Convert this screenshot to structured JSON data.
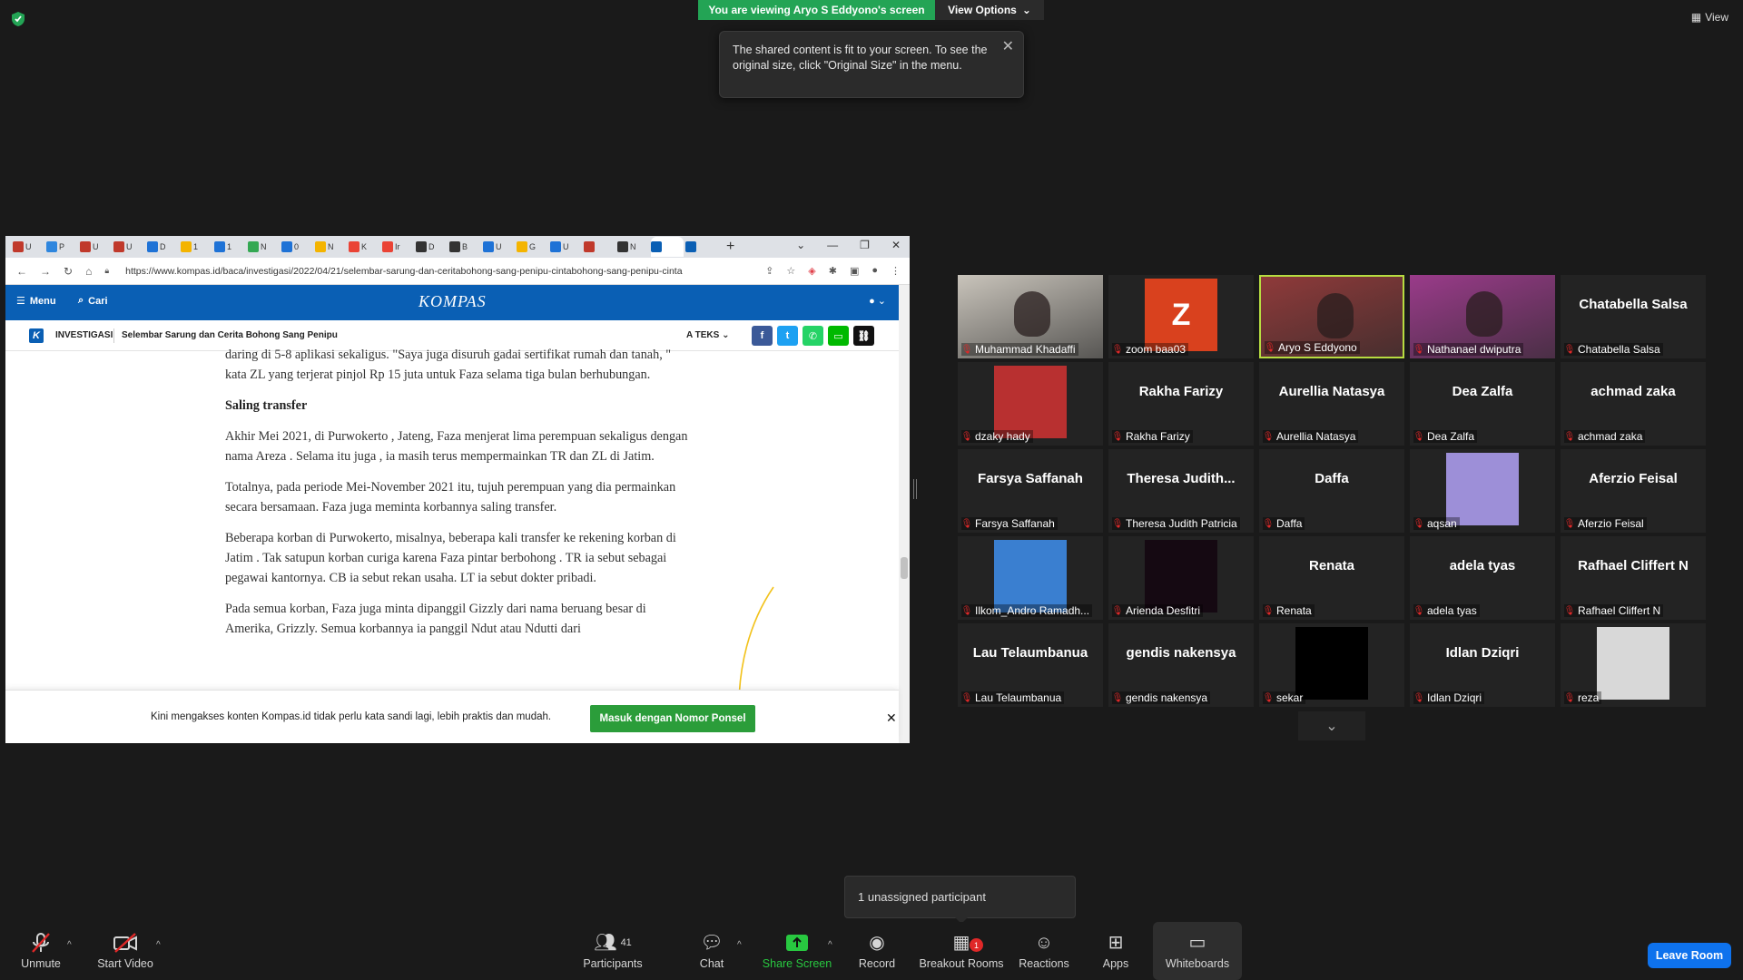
{
  "top": {
    "viewing_banner": "You are viewing Aryo S Eddyono's screen",
    "view_options": "View Options",
    "tooltip_text": "The shared content is fit to your screen. To see the original size, click \"Original Size\" in the menu.",
    "view_label": "View"
  },
  "browser": {
    "tabs": [
      "U",
      "P",
      "U",
      "U",
      "D",
      "1",
      "1",
      "N",
      "0",
      "N",
      "K",
      "Ir",
      "D",
      "B",
      "U",
      "G",
      "U",
      "",
      "N",
      "",
      ""
    ],
    "url": "https://www.kompas.id/baca/investigasi/2022/04/21/selembar-sarung-dan-ceritabohong-sang-penipu-cintabohong-sang-penipu-cinta",
    "kompas": {
      "menu": "Menu",
      "search": "Cari",
      "logo": "KOMPAS",
      "category": "INVESTIGASI",
      "article_title": "Selembar Sarung dan Cerita Bohong Sang Penipu",
      "text_size": "TEKS"
    },
    "article": {
      "p1": "daring di 5-8 aplikasi sekaligus. \"Saya juga disuruh gadai sertifikat rumah dan tanah, \" kata ZL yang terjerat pinjol Rp 15 juta untuk Faza selama tiga bulan berhubungan.",
      "heading": "Saling transfer",
      "p2": "Akhir Mei 2021, di Purwokerto , Jateng, Faza menjerat lima perempuan sekaligus dengan nama Areza . Selama itu juga , ia masih terus mempermainkan TR dan ZL di Jatim.",
      "p3": "Totalnya, pada periode Mei-November 2021 itu, tujuh perempuan yang dia permainkan secara bersamaan. Faza juga meminta korbannya saling transfer.",
      "p4": "Beberapa korban di Purwokerto, misalnya, beberapa kali transfer ke rekening korban di Jatim . Tak satupun korban curiga karena Faza pintar berbohong . TR ia sebut sebagai pegawai kantornya. CB ia sebut rekan usaha. LT ia sebut dokter pribadi.",
      "p5": "Pada semua korban, Faza juga minta dipanggil Gizzly dari nama beruang besar di Amerika, Grizzly. Semua korbannya ia panggil Ndut atau Ndutti dari"
    },
    "login_banner": {
      "text": "Kini mengakses konten Kompas.id tidak perlu kata sandi lagi, lebih praktis dan mudah.",
      "button": "Masuk dengan Nomor Ponsel"
    }
  },
  "gallery": [
    {
      "label": "Muhammad Khadaffi",
      "type": "video",
      "color": "#c9c4bb"
    },
    {
      "label": "zoom baa03",
      "type": "initial",
      "initial": "Z",
      "color": "#d9411e"
    },
    {
      "label": "Aryo S Eddyono",
      "type": "video",
      "color": "#8f3a3a",
      "active": true
    },
    {
      "label": "Nathanael dwiputra",
      "type": "video",
      "color": "#9a3b8a"
    },
    {
      "label": "Chatabella Salsa",
      "type": "name",
      "name": "Chatabella Salsa"
    },
    {
      "label": "dzaky hady",
      "type": "avatar",
      "color": "#b83030"
    },
    {
      "label": "Rakha Farizy",
      "type": "name",
      "name": "Rakha Farizy"
    },
    {
      "label": "Aurellia Natasya",
      "type": "name",
      "name": "Aurellia Natasya"
    },
    {
      "label": "Dea Zalfa",
      "type": "name",
      "name": "Dea Zalfa"
    },
    {
      "label": "achmad zaka",
      "type": "name",
      "name": "achmad zaka"
    },
    {
      "label": "Farsya Saffanah",
      "type": "name",
      "name": "Farsya Saffanah"
    },
    {
      "label": "Theresa Judith Patricia",
      "type": "name",
      "name": "Theresa Judith..."
    },
    {
      "label": "Daffa",
      "type": "name",
      "name": "Daffa"
    },
    {
      "label": "aqsan",
      "type": "avatar",
      "color": "#9d8fd8"
    },
    {
      "label": "Aferzio Feisal",
      "type": "name",
      "name": "Aferzio Feisal"
    },
    {
      "label": "Ilkom_Andro Ramadh...",
      "type": "avatar",
      "color": "#3a7fd0"
    },
    {
      "label": "Arienda Desfitri",
      "type": "avatar",
      "color": "#150912"
    },
    {
      "label": "Renata",
      "type": "name",
      "name": "Renata"
    },
    {
      "label": "adela tyas",
      "type": "name",
      "name": "adela tyas"
    },
    {
      "label": "Rafhael Cliffert N",
      "type": "name",
      "name": "Rafhael Cliffert N"
    },
    {
      "label": "Lau Telaumbanua",
      "type": "name",
      "name": "Lau Telaumbanua"
    },
    {
      "label": "gendis nakensya",
      "type": "name",
      "name": "gendis nakensya"
    },
    {
      "label": "sekar",
      "type": "avatar",
      "color": "#000000"
    },
    {
      "label": "Idlan Dziqri",
      "type": "name",
      "name": "Idlan Dziqri"
    },
    {
      "label": "reza",
      "type": "avatar",
      "color": "#d8d8d8"
    }
  ],
  "unassigned": "1 unassigned participant",
  "toolbar": {
    "unmute": "Unmute",
    "start_video": "Start Video",
    "participants": "Participants",
    "participants_count": "41",
    "chat": "Chat",
    "share_screen": "Share Screen",
    "record": "Record",
    "breakout_rooms": "Breakout Rooms",
    "breakout_badge": "1",
    "reactions": "Reactions",
    "apps": "Apps",
    "whiteboards": "Whiteboards",
    "leave": "Leave Room"
  }
}
